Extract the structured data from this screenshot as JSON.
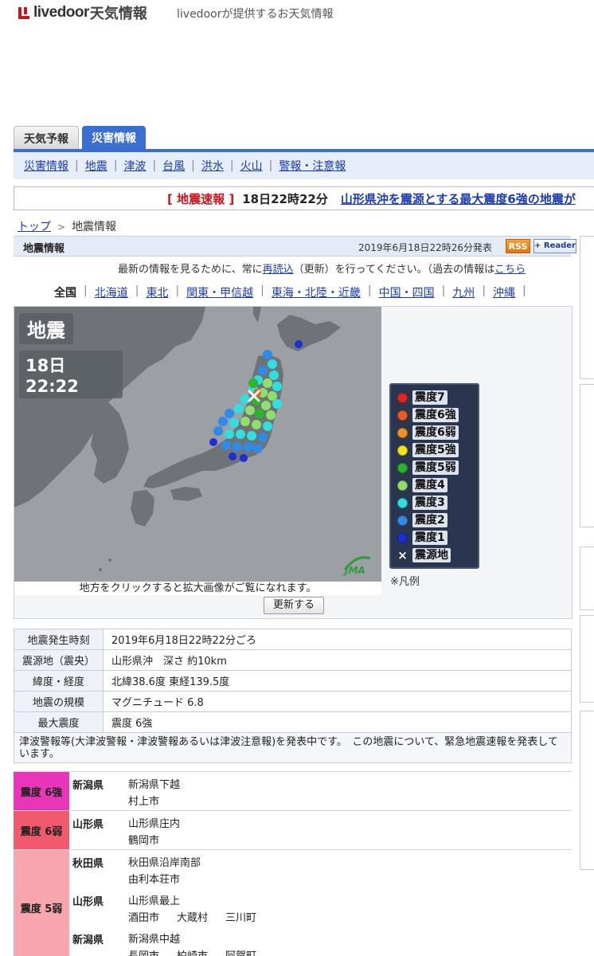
{
  "header": {
    "brand": "livedoor",
    "brand_suffix": "天気情報",
    "tagline": "livedoorが提供するお天気情報"
  },
  "main_tabs": [
    {
      "label": "天気予報",
      "active": false
    },
    {
      "label": "災害情報",
      "active": true
    }
  ],
  "sub_nav": [
    "災害情報",
    "地震",
    "津波",
    "台風",
    "洪水",
    "火山",
    "警報・注意報"
  ],
  "flash": {
    "open": "[",
    "tag": "地震速報",
    "close": "]",
    "time": "18日22時22分",
    "headline": "山形県沖を震源とする最大震度6強の地震が"
  },
  "breadcrumb": {
    "home": "トップ",
    "sep": ">",
    "current": "地震情報"
  },
  "info_header": {
    "title": "地震情報",
    "published": "2019年6月18日22時26分発表",
    "rss": "RSS",
    "reader": "+ Reader"
  },
  "reload_note": {
    "before": "最新の情報を見るために、常に",
    "link": "再読込",
    "after": "（更新）を行ってください。（過去の情報は",
    "link2": "こちら",
    "end": ")"
  },
  "regions": {
    "current": "全国",
    "items": [
      "北海道",
      "東北",
      "関東・甲信越",
      "東海・北陸・近畿",
      "中国・四国",
      "九州",
      "沖縄"
    ]
  },
  "map": {
    "title": "地震",
    "time": "18日22:22",
    "caption": "地方をクリックすると拡大画像がご覧になれます。",
    "legend_note": "※凡例",
    "update_button": "更新する",
    "legend": [
      {
        "label": "震度7",
        "color": "#e8231f"
      },
      {
        "label": "震度6強",
        "color": "#f05a1e"
      },
      {
        "label": "震度6弱",
        "color": "#f5921f"
      },
      {
        "label": "震度5強",
        "color": "#f2e514"
      },
      {
        "label": "震度5弱",
        "color": "#2bb52a"
      },
      {
        "label": "震度4",
        "color": "#8fe06a"
      },
      {
        "label": "震度3",
        "color": "#2ee0e0"
      },
      {
        "label": "震度2",
        "color": "#2f8be8"
      },
      {
        "label": "震度1",
        "color": "#1c2fd6"
      },
      {
        "label": "震源地",
        "symbol": "×"
      }
    ]
  },
  "info_table": [
    {
      "label": "地震発生時刻",
      "value": "2019年6月18日22時22分ごろ"
    },
    {
      "label": "震源地（震央）",
      "value": "山形県沖　深さ 約10km"
    },
    {
      "label": "緯度・経度",
      "value": "北緯38.6度 東経139.5度"
    },
    {
      "label": "地震の規模",
      "value": "マグニチュード 6.8"
    },
    {
      "label": "最大震度",
      "value": "震度 6強"
    }
  ],
  "tsunami_note": "津波警報等(大津波警報・津波警報あるいは津波注意報)を発表中です。　この地震について、緊急地震速報を発表しています。",
  "intensity": [
    {
      "level": "震度 6強",
      "color": "#e936b8",
      "rows": [
        {
          "pref": "新潟県",
          "areas": [
            [
              "新潟県下越"
            ],
            [
              "村上市"
            ]
          ]
        }
      ]
    },
    {
      "level": "震度 6弱",
      "color": "#f05a6c",
      "rows": [
        {
          "pref": "山形県",
          "areas": [
            [
              "山形県庄内"
            ],
            [
              "鶴岡市"
            ]
          ]
        }
      ]
    },
    {
      "level": "震度 5弱",
      "color": "#f7a6ad",
      "rows": [
        {
          "pref": "秋田県",
          "areas": [
            [
              "秋田県沿岸南部"
            ],
            [
              "由利本荘市"
            ]
          ]
        },
        {
          "pref": "山形県",
          "areas": [
            [
              "山形県最上"
            ],
            [
              "酒田市",
              "大蔵村",
              "三川町"
            ]
          ]
        },
        {
          "pref": "新潟県",
          "areas": [
            [
              "新潟県中越"
            ],
            [
              "長岡市",
              "柏崎市",
              "阿賀町"
            ]
          ]
        }
      ]
    }
  ]
}
